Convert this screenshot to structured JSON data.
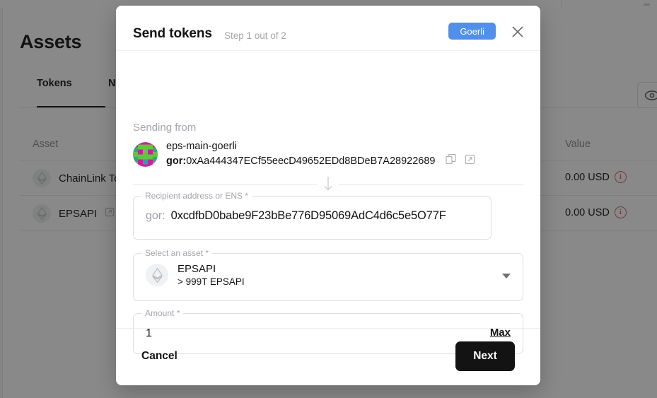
{
  "background": {
    "page_title": "Assets",
    "tabs": [
      {
        "label": "Tokens",
        "active": true
      },
      {
        "label": "NFTs",
        "active": false
      }
    ],
    "toggle_balance_icon": "eye-icon",
    "table": {
      "headers": {
        "asset": "Asset",
        "value": "Value"
      },
      "rows": [
        {
          "asset": "ChainLink Token",
          "value": "0.00 USD",
          "warning_icon": "info-circle-icon",
          "has_external_link": false
        },
        {
          "asset": "EPSAPI",
          "value": "0.00 USD",
          "warning_icon": "info-circle-icon",
          "has_external_link": true
        }
      ]
    }
  },
  "modal": {
    "title": "Send tokens",
    "step": "Step 1 out of 2",
    "chain_badge": "Goerli",
    "chain_badge_color": "#5090ea",
    "close_icon": "close-icon",
    "sending_from": {
      "label": "Sending from",
      "account_name": "eps-main-goerli",
      "address_prefix": "gor:",
      "address": "0xAa444347ECf55eecD49652EDd8BDeB7A28922689",
      "copy_icon": "copy-icon",
      "explorer_icon": "external-link-icon"
    },
    "flow_arrow_icon": "arrow-down-icon",
    "recipient": {
      "legend": "Recipient address or ENS *",
      "prefix": "gor:",
      "value": "0xcdfbD0babe9F23bBe776D95069AdC4d6c5e5O77F",
      "scan_icon": "qr-code-icon"
    },
    "asset": {
      "legend": "Select an asset *",
      "symbol": "EPSAPI",
      "balance": "> 999T EPSAPI",
      "coin_icon": "ethereum-diamond-icon",
      "dropdown_icon": "chevron-down-icon"
    },
    "amount": {
      "legend": "Amount *",
      "value": "1",
      "max_label": "Max"
    },
    "footer": {
      "cancel_label": "Cancel",
      "next_label": "Next"
    }
  }
}
